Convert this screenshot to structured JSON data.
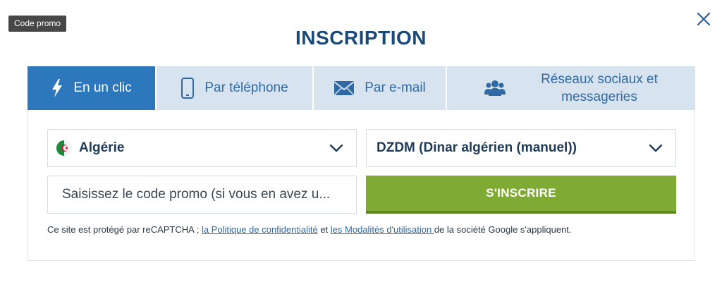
{
  "tooltip": {
    "text": "Code promo"
  },
  "modal": {
    "title": "INSCRIPTION",
    "close_icon": "close-icon"
  },
  "tabs": [
    {
      "label": "En un clic",
      "icon": "lightning-icon",
      "active": true
    },
    {
      "label": "Par téléphone",
      "icon": "phone-icon",
      "active": false
    },
    {
      "label": "Par e-mail",
      "icon": "envelope-icon",
      "active": false
    },
    {
      "label_line1": "Réseaux sociaux et",
      "label_line2": "messageries",
      "icon": "users-icon",
      "active": false
    }
  ],
  "form": {
    "country": {
      "value": "Algérie",
      "flag": "algeria-flag-icon"
    },
    "currency": {
      "value": "DZDM (Dinar algérien (manuel))"
    },
    "promo": {
      "placeholder": "Saisissez le code promo (si vous en avez u..."
    },
    "submit_label": "S'INSCRIRE"
  },
  "legal": {
    "prefix": "Ce site est protégé par reCAPTCHA ; ",
    "privacy_link": "la Politique de confidentialité",
    "middle": " et ",
    "terms_link": "les Modalités d'utilisation ",
    "suffix": "de la société Google s'appliquent."
  },
  "colors": {
    "title": "#1b4a78",
    "tab_active": "#2d77bd",
    "tab_inactive": "#d7e3ee",
    "tab_text": "#2f6aa4",
    "submit": "#7fab35"
  }
}
